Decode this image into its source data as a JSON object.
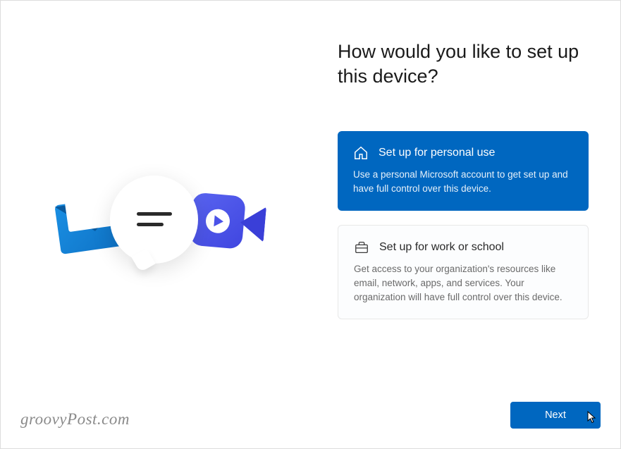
{
  "heading": "How would you like to set up this device?",
  "options": {
    "personal": {
      "title": "Set up for personal use",
      "description": "Use a personal Microsoft account to get set up and have full control over this device."
    },
    "work": {
      "title": "Set up for work or school",
      "description": "Get access to your organization's resources like email, network, apps, and services. Your organization will have full control over this device."
    }
  },
  "buttons": {
    "next": "Next"
  },
  "watermark": "groovyPost.com",
  "colors": {
    "accent": "#0067c0"
  }
}
